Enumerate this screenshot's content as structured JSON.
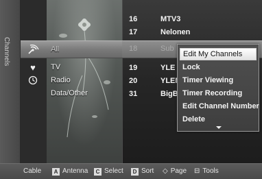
{
  "side_tab": {
    "label": "Channels"
  },
  "categories": [
    {
      "label": "All",
      "icon": "antenna-icon",
      "selected": true
    },
    {
      "label": "TV",
      "icon": "heart-icon"
    },
    {
      "label": "Radio",
      "icon": "clock-icon"
    },
    {
      "label": "Data/Other",
      "icon": ""
    }
  ],
  "channels": [
    {
      "number": "16",
      "name": "MTV3"
    },
    {
      "number": "17",
      "name": "Nelonen"
    },
    {
      "number": "18",
      "name": "Sub"
    },
    {
      "number": "19",
      "name": "YLE P"
    },
    {
      "number": "20",
      "name": "YLEM"
    },
    {
      "number": "31",
      "name": "BigBr"
    }
  ],
  "menu": {
    "items": [
      "Edit My Channels",
      "Lock",
      "Timer Viewing",
      "Timer Recording",
      "Edit Channel Number",
      "Delete"
    ],
    "selected_index": 0
  },
  "bottom_bar": {
    "cable": "Cable",
    "antenna_key": "A",
    "antenna": "Antenna",
    "select_key": "C",
    "select": "Select",
    "sort_key": "D",
    "sort": "Sort",
    "page_glyph": "◇",
    "page": "Page",
    "tools_glyph": "⊟",
    "tools": "Tools"
  }
}
